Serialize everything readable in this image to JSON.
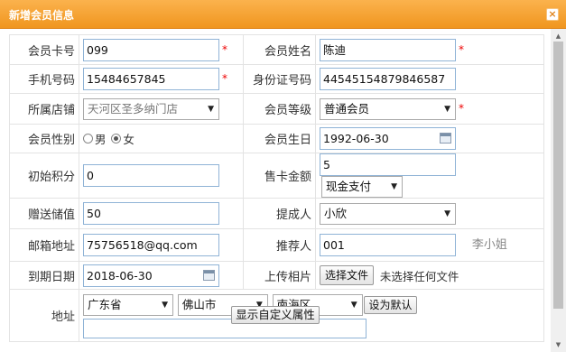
{
  "dialog": {
    "title": "新增会员信息",
    "close_label": "×"
  },
  "form": {
    "card_no": {
      "label": "会员卡号",
      "value": "099",
      "required": "*"
    },
    "name": {
      "label": "会员姓名",
      "value": "陈迪",
      "required": "*"
    },
    "phone": {
      "label": "手机号码",
      "value": "15484657845",
      "required": "*"
    },
    "id_card": {
      "label": "身份证号码",
      "value": "44545154879846587"
    },
    "store": {
      "label": "所属店铺",
      "value": "天河区圣多纳门店"
    },
    "level": {
      "label": "会员等级",
      "value": "普通会员",
      "required": "*"
    },
    "gender": {
      "label": "会员性别",
      "options": [
        "男",
        "女"
      ],
      "selected": "女"
    },
    "birthday": {
      "label": "会员生日",
      "value": "1992-06-30"
    },
    "initial_points": {
      "label": "初始积分",
      "value": "0"
    },
    "card_amount": {
      "label": "售卡金额",
      "value": "5",
      "payment": "现金支付"
    },
    "gift_value": {
      "label": "赠送储值",
      "value": "50"
    },
    "proposer": {
      "label": "提成人",
      "value": "小欣"
    },
    "email": {
      "label": "邮箱地址",
      "value": "75756518@qq.com"
    },
    "referrer": {
      "label": "推荐人",
      "value": "001",
      "name": "李小姐"
    },
    "expire": {
      "label": "到期日期",
      "value": "2018-06-30"
    },
    "photo": {
      "label": "上传相片",
      "button": "选择文件",
      "status": "未选择任何文件"
    },
    "address": {
      "label": "地址",
      "province": "广东省",
      "city": "佛山市",
      "district": "南海区",
      "default_button": "设为默认",
      "detail": ""
    }
  },
  "footer": {
    "custom_attr_button": "显示自定义属性"
  },
  "icons": {
    "close": "close-icon",
    "calendar": "calendar-icon",
    "dropdown": "chevron-down-icon"
  }
}
